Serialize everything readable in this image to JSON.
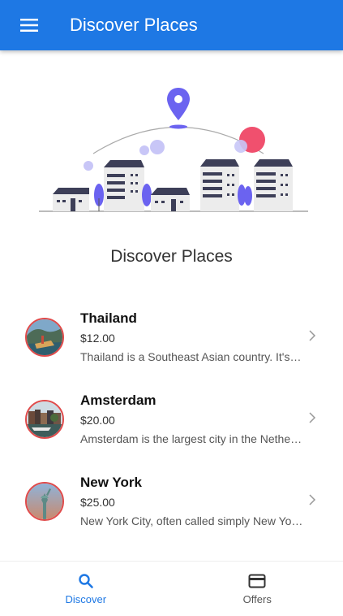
{
  "app_bar": {
    "title": "Discover Places",
    "menu_icon": "menu-icon"
  },
  "section": {
    "title": "Discover Places"
  },
  "places": [
    {
      "name": "Thailand",
      "price": "$12.00",
      "description": "Thailand is a Southeast Asian country. It's known for tropical beaches, opulent royal palaces and ancient ruins"
    },
    {
      "name": "Amsterdam",
      "price": "$20.00",
      "description": "Amsterdam is the largest city in the Netherlands, known for its artistic heritage and canals"
    },
    {
      "name": "New York",
      "price": "$25.00",
      "description": "New York City, often called simply New York, is the most populous city in the United States"
    }
  ],
  "bottom_nav": {
    "tabs": [
      {
        "label": "Discover",
        "icon": "search-icon",
        "active": true
      },
      {
        "label": "Offers",
        "icon": "card-icon",
        "active": false
      }
    ]
  },
  "colors": {
    "primary": "#1e78e4",
    "avatar_border": "#e04b4b",
    "accent_purple": "#6b63f0",
    "accent_pink": "#f0506e"
  }
}
